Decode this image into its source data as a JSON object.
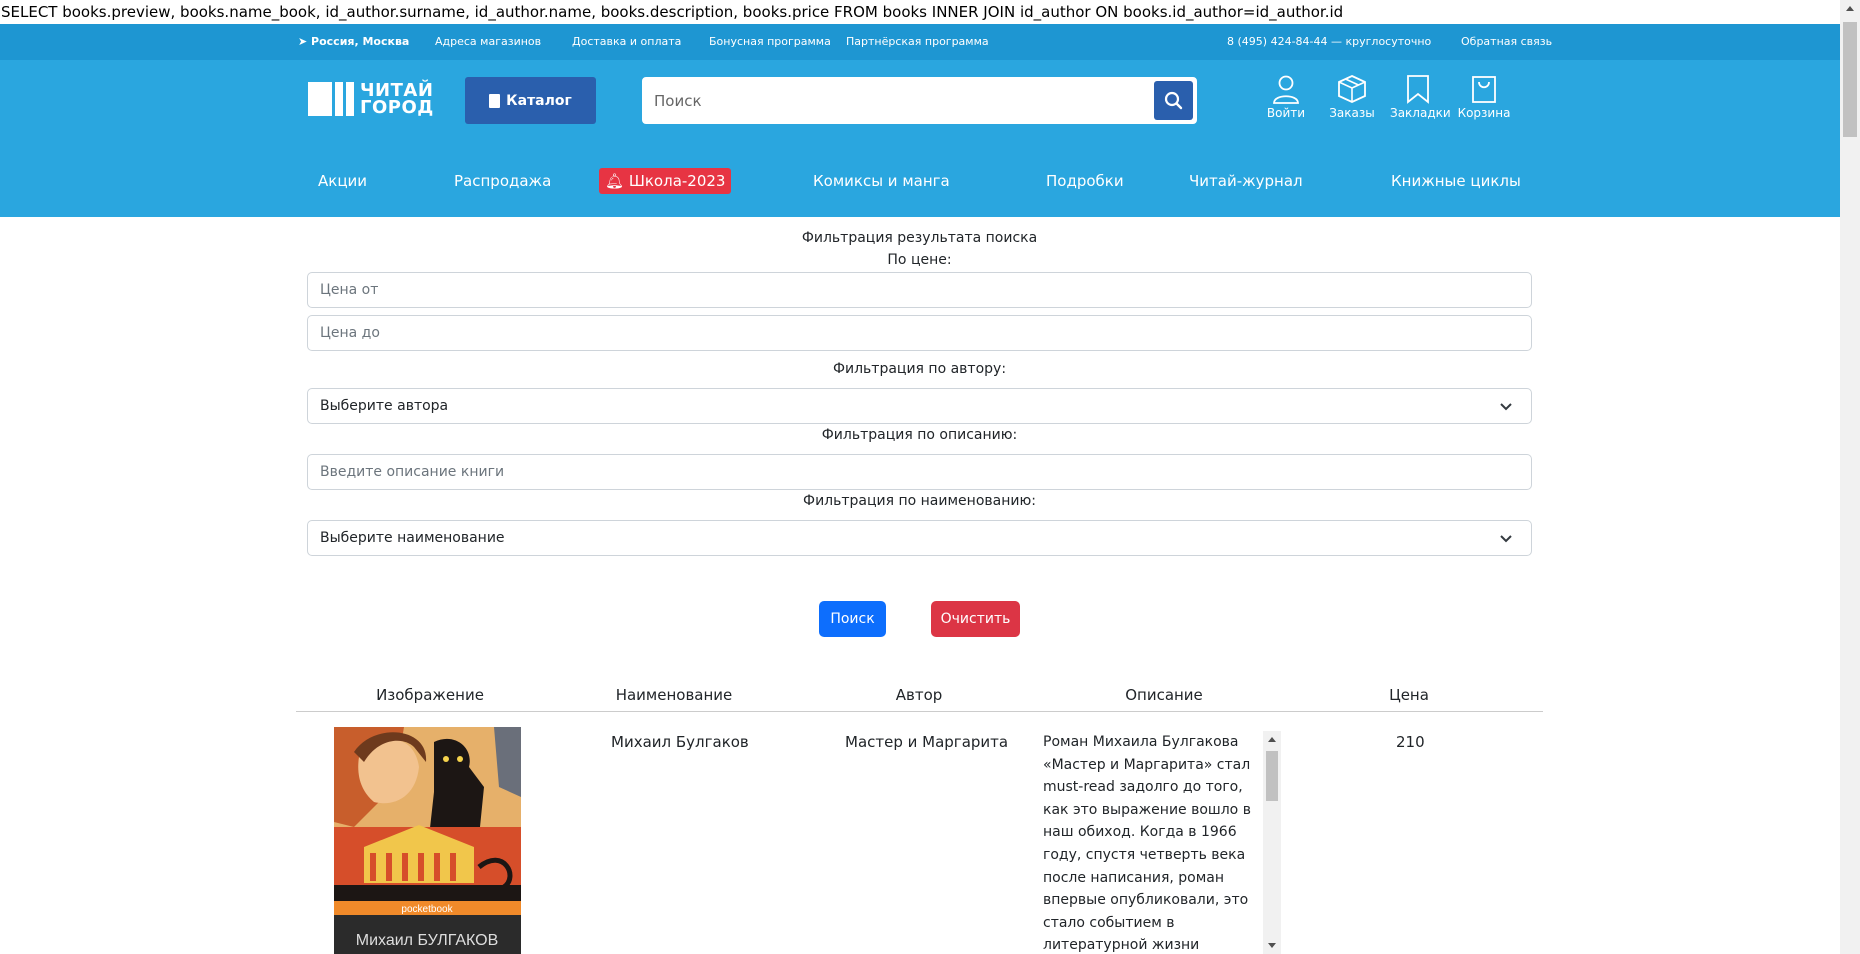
{
  "query_text": "SELECT books.preview, books.name_book, id_author.surname, id_author.name, books.description, books.price FROM books INNER JOIN id_author ON books.id_author=id_author.id",
  "topbar": {
    "location": "Россия, Москва",
    "stores": "Адреса магазинов",
    "delivery": "Доставка и оплата",
    "bonus": "Бонусная программа",
    "partner": "Партнёрская программа",
    "phone": "8 (495) 424-84-44 — круглосуточно",
    "feedback": "Обратная связь"
  },
  "header": {
    "logo_line1": "ЧИТАЙ",
    "logo_line2": "ГОРОД",
    "catalog_label": "Каталог",
    "search_placeholder": "Поиск",
    "icons": {
      "login": "Войти",
      "orders": "Заказы",
      "bookmarks": "Закладки",
      "cart": "Корзина"
    }
  },
  "nav": {
    "items": [
      "Акции",
      "Распродажа",
      "Школа-2023",
      "Комиксы и манга",
      "Подробки",
      "Читай-журнал",
      "Книжные циклы"
    ]
  },
  "filters": {
    "title": "Фильтрация результата поиска",
    "price_label": "По цене:",
    "price_from_placeholder": "Цена от",
    "price_to_placeholder": "Цена до",
    "author_label": "Фильтрация по автору:",
    "author_selected": "Выберите автора",
    "description_label": "Фильтрация по описанию:",
    "description_placeholder": "Введите описание книги",
    "name_label": "Фильтрация по наименованию:",
    "name_selected": "Выберите наименование",
    "search_button": "Поиск",
    "clear_button": "Очистить"
  },
  "table": {
    "headers": [
      "Изображение",
      "Наименование",
      "Автор",
      "Описание",
      "Цена"
    ],
    "rows": [
      {
        "cover_brand": "pocketbook",
        "cover_author": "Михаил БУЛГАКОВ",
        "name": "Михаил Булгаков",
        "author": "Мастер и Маргарита",
        "description": "Роман Михаила Булгакова «Мастер и Маргарита» стал must-read задолго до того, как это выражение вошло в наш обиход. Когда в 1966 году, спустя четверть века после написания, роман впервые опубликовали, это стало событием в литературной жизни страны. Невозможно",
        "price": "210"
      }
    ]
  },
  "colors": {
    "topbar": "#1e96d2",
    "header": "#2aa6df",
    "catalog": "#2a5fad",
    "school_badge": "#e73443",
    "primary": "#0d6efd",
    "danger": "#dc3545"
  }
}
